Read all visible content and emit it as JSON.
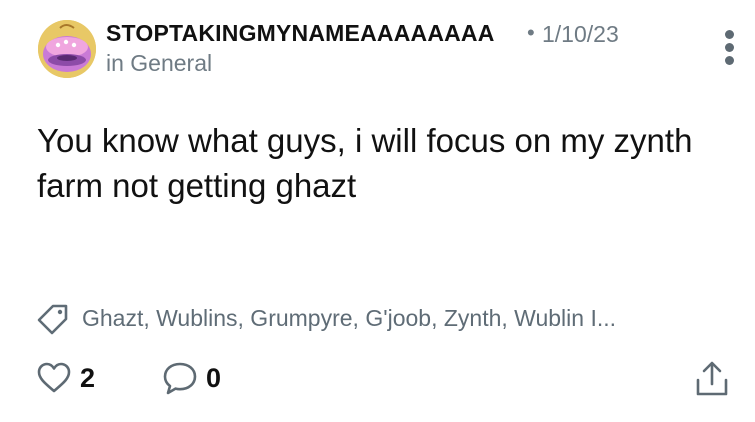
{
  "post": {
    "username": "STOPTAKINGMYNAMEAAAAAAAA",
    "separator": "•",
    "date": "1/10/23",
    "category": "in General",
    "body": "You know what guys, i will focus on my zynth farm not getting ghazt",
    "tags": "Ghazt, Wublins, Grumpyre, G'joob, Zynth, Wublin I...",
    "likes": "2",
    "comments": "0"
  },
  "icons": {
    "avatar": "monster-avatar",
    "more": "more-vertical-icon",
    "tag": "tag-icon",
    "like": "heart-icon",
    "comment": "comment-icon",
    "share": "share-icon"
  },
  "colors": {
    "text": "#111111",
    "muted": "#6f7b84",
    "icon": "#5e6a73"
  }
}
